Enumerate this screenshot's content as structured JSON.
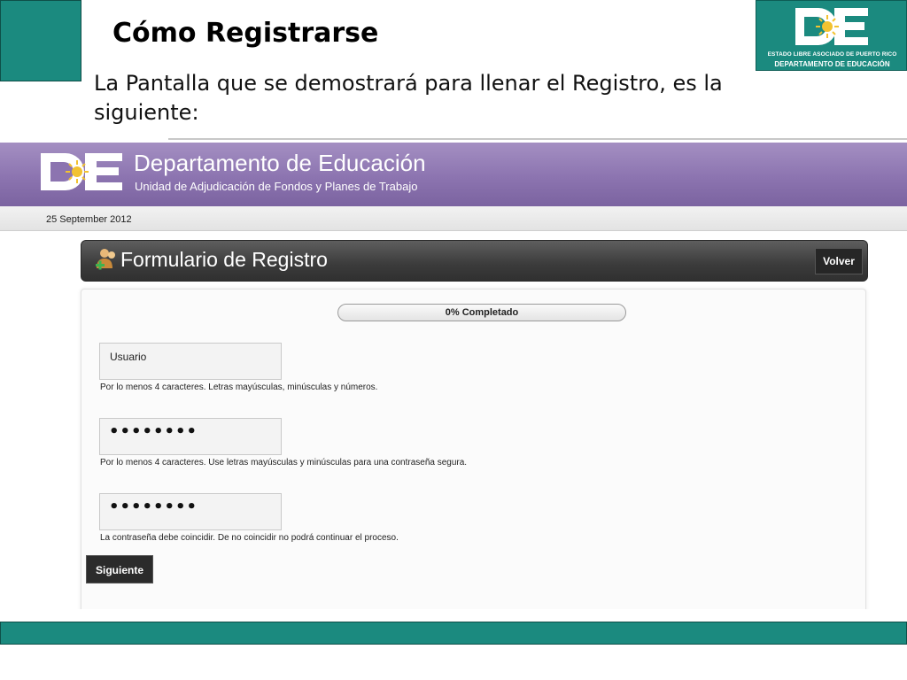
{
  "slide": {
    "title": "Cómo Registrarse",
    "subtitle": "La Pantalla que se demostrará para llenar el Registro, es la siguiente:",
    "logo_line1": "ESTADO LIBRE ASOCIADO DE PUERTO RICO",
    "logo_line2": "DEPARTAMENTO DE EDUCACIÓN",
    "logo_mark": "DE",
    "accent_color": "#1b8a7f"
  },
  "app": {
    "banner_title": "Departamento de Educación",
    "banner_subtitle": "Unidad de Adjudicación de Fondos y Planes de Trabajo",
    "banner_color": "#8c74b0",
    "date": "25 September 2012"
  },
  "form": {
    "title": "Formulario de Registro",
    "back_label": "Volver",
    "progress_label": "0% Completado",
    "progress_value": 0,
    "username_value": "Usuario",
    "username_hint": "Por lo menos 4 caracteres. Letras mayúsculas, minúsculas y números.",
    "password_value": "••••••••",
    "password_hint": "Por lo menos 4 caracteres. Use letras mayúsculas y minúsculas para una contraseña segura.",
    "confirm_value": "••••••••",
    "confirm_hint": "La contraseña debe coincidir. De no coincidir no podrá continuar el proceso.",
    "next_label": "Siguiente"
  }
}
